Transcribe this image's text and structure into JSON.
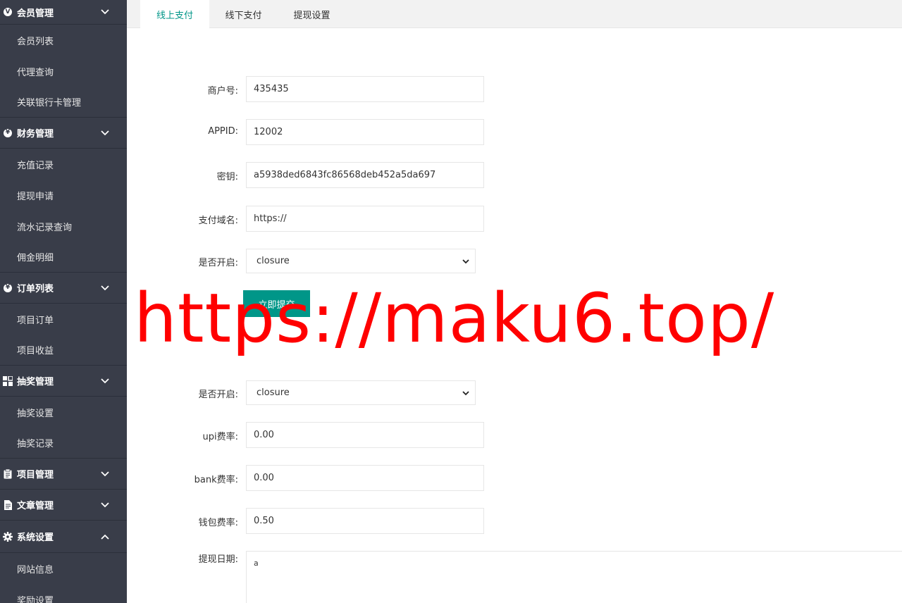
{
  "sidebar": {
    "groups": [
      {
        "label": "会员管理",
        "icon": "v-coin-icon",
        "items": [
          "会员列表",
          "代理查询",
          "关联银行卡管理"
        ]
      },
      {
        "label": "财务管理",
        "icon": "yen-coin-icon",
        "items": [
          "充值记录",
          "提现申请",
          "流水记录查询",
          "佣金明细"
        ]
      },
      {
        "label": "订单列表",
        "icon": "yen-coin-icon",
        "items": [
          "项目订单",
          "项目收益"
        ]
      },
      {
        "label": "抽奖管理",
        "icon": "grid-icon",
        "items": [
          "抽奖设置",
          "抽奖记录"
        ]
      },
      {
        "label": "项目管理",
        "icon": "clipboard-icon",
        "items": []
      },
      {
        "label": "文章管理",
        "icon": "document-icon",
        "items": []
      },
      {
        "label": "系统设置",
        "icon": "gear-icon",
        "items": [
          "网站信息",
          "奖励设置"
        ]
      }
    ]
  },
  "tabs": [
    "线上支付",
    "线下支付",
    "提现设置"
  ],
  "form": {
    "merchant_label": "商户号:",
    "merchant_value": "435435",
    "appid_label": "APPID:",
    "appid_value": "12002",
    "secret_label": "密钥:",
    "secret_value": "a5938ded6843fc86568deb452a5da697",
    "domain_label": "支付域名:",
    "domain_value": "https://",
    "enable_label": "是否开启:",
    "enable_value": "closure",
    "submit_label": "立即提交",
    "enable2_label": "是否开启:",
    "enable2_value": "closure",
    "upi_label": "upi费率:",
    "upi_value": "0.00",
    "bank_label": "bank费率:",
    "bank_value": "0.00",
    "wallet_label": "钱包费率:",
    "wallet_value": "0.50",
    "date_label": "提现日期:",
    "date_value": "a"
  },
  "watermark": "https://maku6.top/",
  "colors": {
    "sidebar_bg": "#393d49",
    "accent": "#009688",
    "watermark": "#ff0000"
  }
}
